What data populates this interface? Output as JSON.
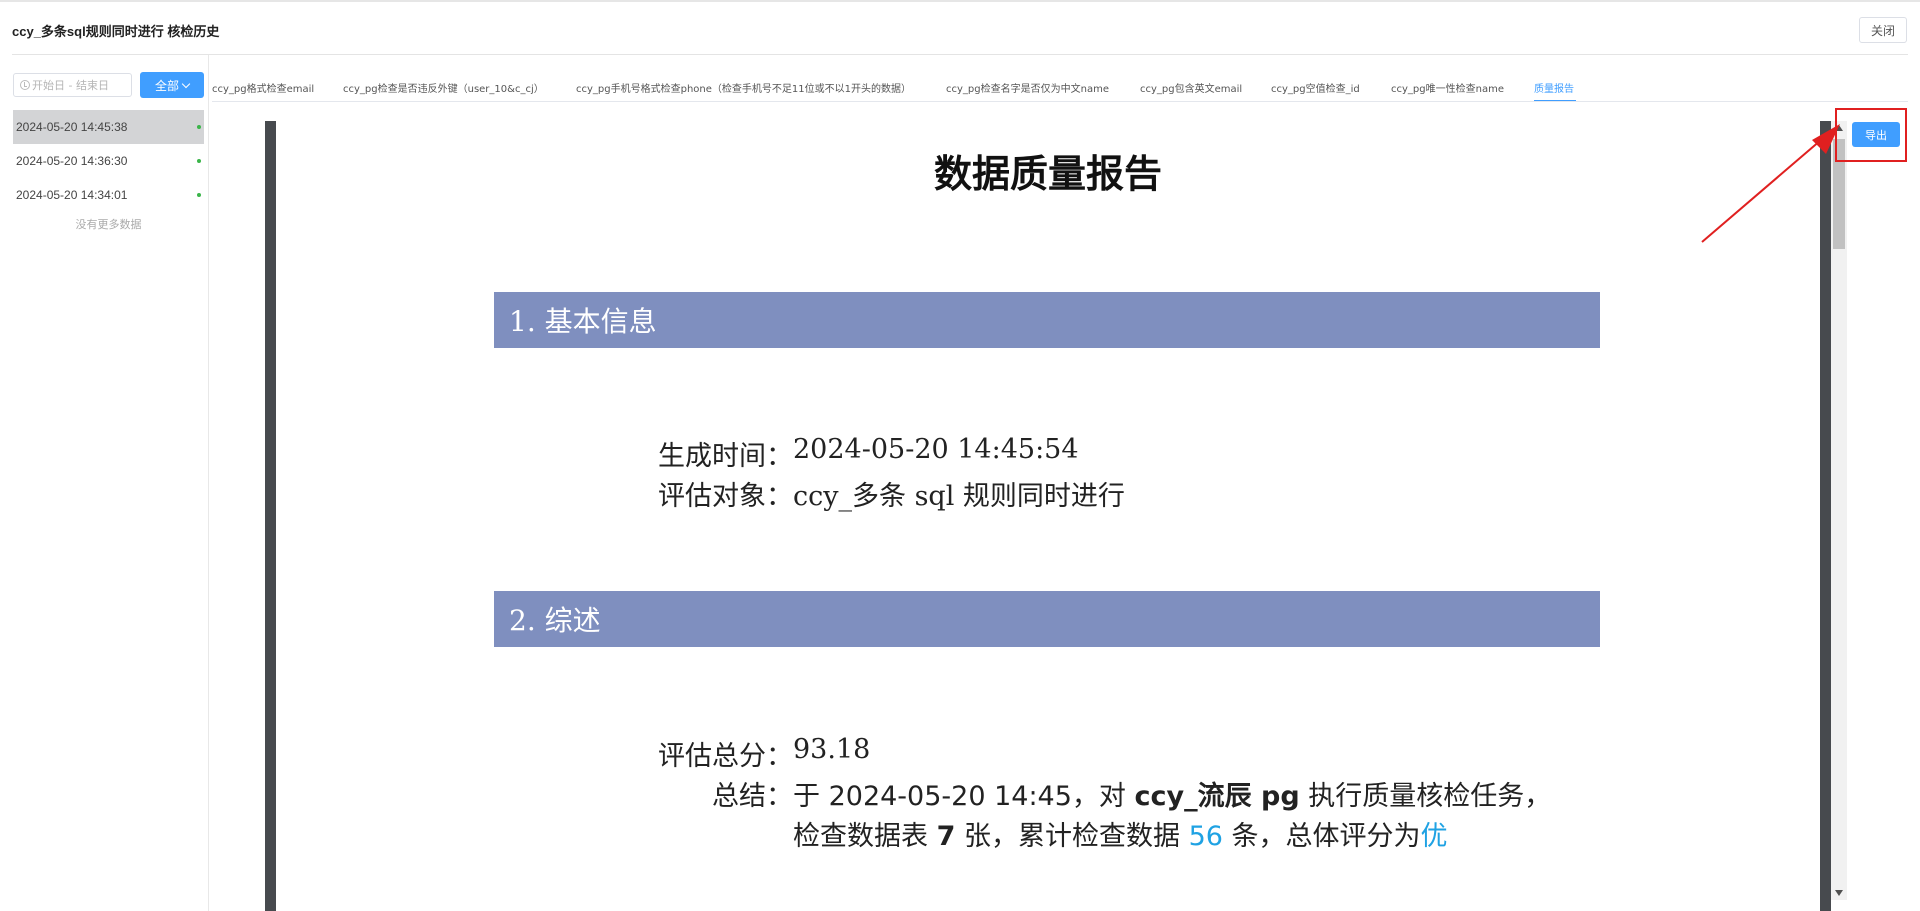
{
  "header": {
    "title": "ccy_多条sql规则同时进行 核检历史",
    "close_label": "关闭"
  },
  "sidebar": {
    "date_placeholder": "开始日 - 结束日",
    "filter_label": "全部",
    "history": [
      {
        "time": "2024-05-20 14:45:38",
        "status": "success"
      },
      {
        "time": "2024-05-20 14:36:30",
        "status": "success"
      },
      {
        "time": "2024-05-20 14:34:01",
        "status": "success"
      }
    ],
    "no_more": "没有更多数据"
  },
  "tabs": [
    {
      "label": "ccy_pg格式检查email"
    },
    {
      "label": "ccy_pg检查是否违反外键（user_10&c_cj）"
    },
    {
      "label": "ccy_pg手机号格式检查phone（检查手机号不足11位或不以1开头的数据）"
    },
    {
      "label": "ccy_pg检查名字是否仅为中文name"
    },
    {
      "label": "ccy_pg包含英文email"
    },
    {
      "label": "ccy_pg空值检查_id"
    },
    {
      "label": "ccy_pg唯一性检查name"
    },
    {
      "label": "质量报告"
    }
  ],
  "report": {
    "title": "数据质量报告",
    "section1": "1. 基本信息",
    "gen_time_label": "生成时间：",
    "gen_time_value": "2024-05-20 14:45:54",
    "target_label": "评估对象：",
    "target_value": "ccy_多条 sql 规则同时进行",
    "section2": "2. 综述",
    "score_label": "评估总分：",
    "score_value": "93.18",
    "summary_label": "总结：",
    "summary_line1_a": "于 ",
    "summary_time": "2024-05-20 14:45",
    "summary_line1_b": "，对 ",
    "summary_target": "ccy_流辰 pg",
    "summary_line1_c": " 执行质量核检任务，",
    "summary_line2_a": "检查数据表 ",
    "summary_tables": "7",
    "summary_line2_b": " 张，累计检查数据 ",
    "summary_rows": "56",
    "summary_line2_c": " 条，总体评分为",
    "summary_grade": "优"
  },
  "export_label": "导出",
  "colors": {
    "primary": "#409eff",
    "section_bg": "#7f8fbf",
    "highlight": "#1fa2e3",
    "annotation": "#e02020"
  }
}
